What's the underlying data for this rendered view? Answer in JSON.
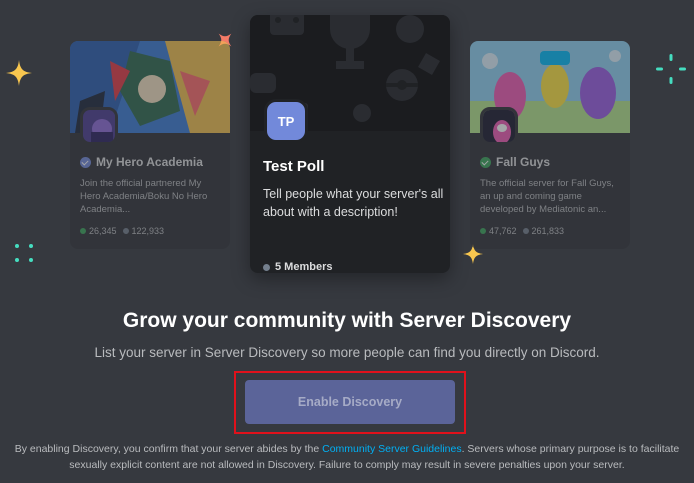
{
  "colors": {
    "background": "#36393f",
    "card": "#2f3136",
    "blurple": "#7289da",
    "button": "#5b6499",
    "link": "#00b0f4",
    "highlight": "#e0111b",
    "partner_badge": "#7289da",
    "verified_badge": "#3ba55c",
    "online_dot": "#3ba55c",
    "members_dot": "#747f8d"
  },
  "decorations": [
    "sparkle-gold-icon",
    "sparkle-pink-icon",
    "sparkle-teal-icon"
  ],
  "cards": {
    "left": {
      "name": "My Hero Academia",
      "badge_icon": "partner-badge-icon",
      "description": "Join the official partnered My Hero Academia/Boku No Hero Academia...",
      "online": "26,345",
      "members": "122,933"
    },
    "main": {
      "icon_initials": "TP",
      "name": "Test Poll",
      "description": "Tell people what your server's all about with a description!",
      "members": "5 Members"
    },
    "right": {
      "name": "Fall Guys",
      "badge_icon": "verified-badge-icon",
      "description": "The official server for Fall Guys, an up and coming game developed by Mediatonic an...",
      "online": "47,762",
      "members": "261,833"
    }
  },
  "headline": "Grow your community with Server Discovery",
  "subheadline": "List your server in Server Discovery so more people can find you directly on Discord.",
  "enable_button": "Enable Discovery",
  "disclaimer": {
    "before_link": "By enabling Discovery, you confirm that your server abides by the ",
    "link": "Community Server Guidelines",
    "after_link": ". Servers whose primary purpose is to facilitate sexually explicit content are not allowed in Discovery. Failure to comply may result in severe penalties upon your server."
  }
}
